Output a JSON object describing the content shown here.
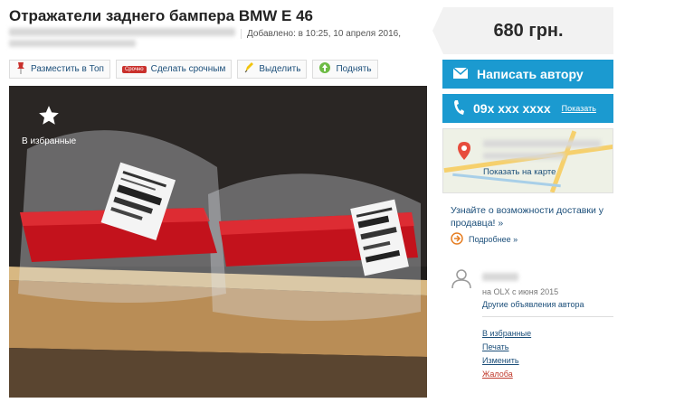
{
  "listing": {
    "title": "Отражатели заднего бампера BMW E 46",
    "added": "Добавлено: в 10:25, 10 апреля 2016,"
  },
  "toolbar": {
    "items": [
      {
        "label": "Разместить в Топ",
        "icon": "pin-icon"
      },
      {
        "label": "Сделать срочным",
        "icon": "urgent-icon"
      },
      {
        "label": "Выделить",
        "icon": "highlight-icon"
      },
      {
        "label": "Поднять",
        "icon": "arrow-up-icon"
      }
    ],
    "urgent_badge": "Срочно"
  },
  "photo": {
    "favorite_label": "В избранные"
  },
  "price": "680 грн.",
  "contact": {
    "write_label": "Написать автору",
    "phone": "09x xxx xxxx",
    "show_label": "Показать"
  },
  "map": {
    "show_label": "Показать на карте"
  },
  "delivery": {
    "text": "Узнайте о возможности доставки у продавца! »",
    "more_label": "Подробнее »"
  },
  "seller": {
    "since": "на OLX с июня 2015",
    "other_ads": "Другие объявления автора"
  },
  "actions": {
    "favorite": "В избранные",
    "print": "Печать",
    "edit": "Изменить",
    "report": "Жалоба"
  },
  "colors": {
    "accent": "#1b9ad0",
    "link": "#1c4f7a",
    "report": "#c0392b"
  }
}
